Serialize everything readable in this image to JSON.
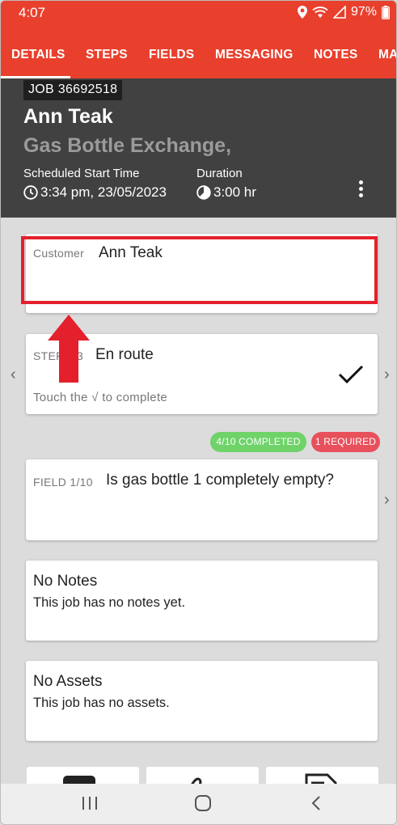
{
  "status_bar": {
    "time": "4:07",
    "battery": "97%",
    "icons": [
      "location-icon",
      "wifi-icon",
      "signal-icon",
      "battery-icon"
    ]
  },
  "tabs": [
    {
      "label": "DETAILS",
      "active": true
    },
    {
      "label": "STEPS",
      "active": false
    },
    {
      "label": "FIELDS",
      "active": false
    },
    {
      "label": "MESSAGING",
      "active": false
    },
    {
      "label": "NOTES",
      "active": false
    },
    {
      "label": "MA",
      "active": false
    }
  ],
  "header": {
    "job_badge": "JOB 36692518",
    "customer_name": "Ann Teak",
    "job_type": "Gas Bottle Exchange,",
    "scheduled_label": "Scheduled Start Time",
    "scheduled_value": "3:34 pm, 23/05/2023",
    "duration_label": "Duration",
    "duration_value": "3:00 hr"
  },
  "customer_card": {
    "label": "Customer",
    "value": "Ann Teak"
  },
  "step_card": {
    "label": "STEP 1/3",
    "value": "En route",
    "hint": "Touch the √ to complete"
  },
  "field_status": {
    "completed": "4/10 COMPLETED",
    "required": "1 REQUIRED"
  },
  "field_card": {
    "label": "FIELD 1/10",
    "value": "Is gas bottle 1 completely empty?"
  },
  "notes_card": {
    "title": "No Notes",
    "text": "This job has no notes yet."
  },
  "assets_card": {
    "title": "No Assets",
    "text": "This job has no assets."
  },
  "colors": {
    "brand": "#e8402d",
    "header_bg": "#414141",
    "highlight": "#e4202c",
    "completed_pill": "#6fd36a",
    "required_pill": "#e8505b"
  }
}
